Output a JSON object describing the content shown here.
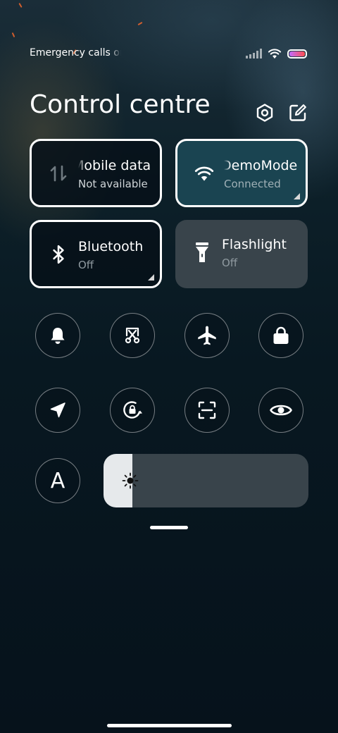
{
  "status_bar": {
    "left_text": "Emergency calls only",
    "icons": [
      "signal-icon",
      "wifi-icon",
      "battery-icon"
    ]
  },
  "header": {
    "title": "Control centre",
    "buttons": [
      "settings-icon",
      "edit-icon"
    ]
  },
  "tiles": {
    "mobile_data": {
      "name": "Mobile data",
      "status": "Not available",
      "icon": "data-transfer-icon"
    },
    "wifi": {
      "name": "DemoMode",
      "status": "Connected",
      "icon": "wifi-icon"
    },
    "bluetooth": {
      "name": "Bluetooth",
      "status": "Off",
      "icon": "bluetooth-icon"
    },
    "flashlight": {
      "name": "Flashlight",
      "status": "Off",
      "icon": "flashlight-icon"
    }
  },
  "toggles_row1": [
    "bell-icon",
    "screenshot-scissors-icon",
    "airplane-icon",
    "lock-icon"
  ],
  "toggles_row2": [
    "location-arrow-icon",
    "rotation-lock-icon",
    "scan-icon",
    "eye-icon"
  ],
  "auto_brightness": {
    "label": "A"
  },
  "brightness": {
    "level": 0.14
  },
  "colors": {
    "background": "#071520",
    "tile_active": "#1a4451",
    "tile_filled": "#39444b",
    "muted_text": "#8f9aa0",
    "active_subtext": "#9fb0b6"
  }
}
